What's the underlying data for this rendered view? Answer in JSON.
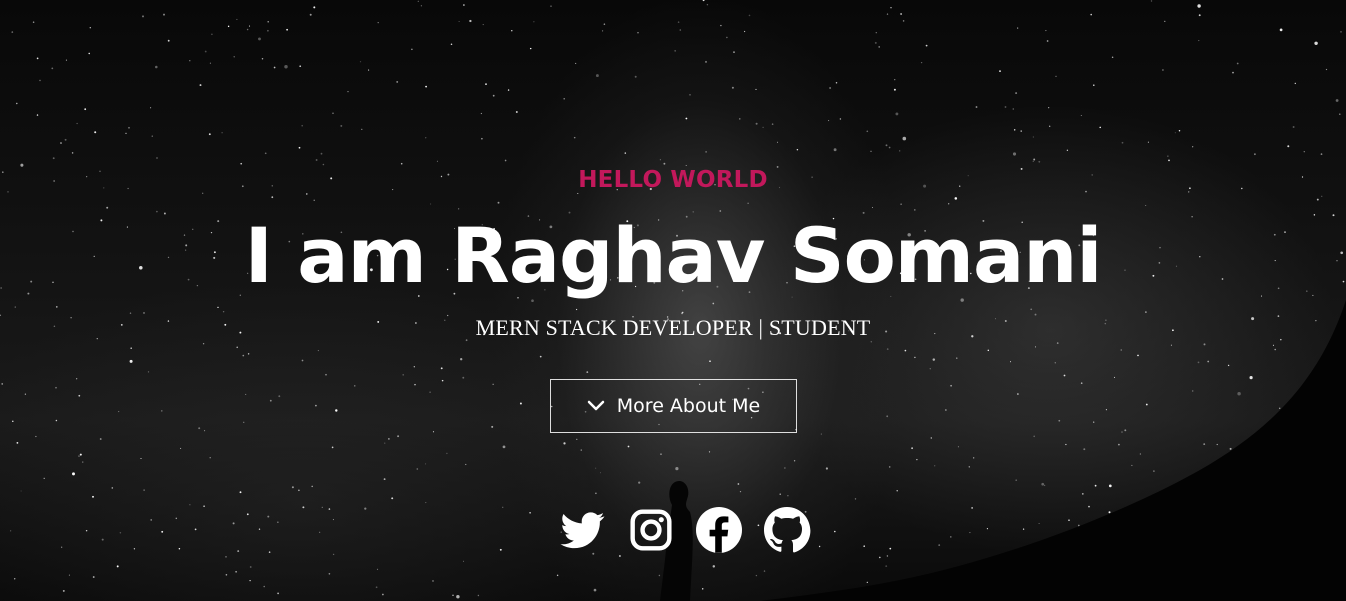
{
  "hero": {
    "eyebrow": "HELLO WORLD",
    "title": "I am Raghav Somani",
    "subtitle": "MERN STACK DEVELOPER | STUDENT",
    "cta_label": "More About Me",
    "cta_icon": "chevron-down-icon"
  },
  "socials": [
    {
      "icon": "twitter-icon"
    },
    {
      "icon": "instagram-icon"
    },
    {
      "icon": "facebook-icon"
    },
    {
      "icon": "github-icon"
    }
  ],
  "colors": {
    "accent": "#c2185b",
    "text": "#ffffff",
    "background": "#000000"
  }
}
